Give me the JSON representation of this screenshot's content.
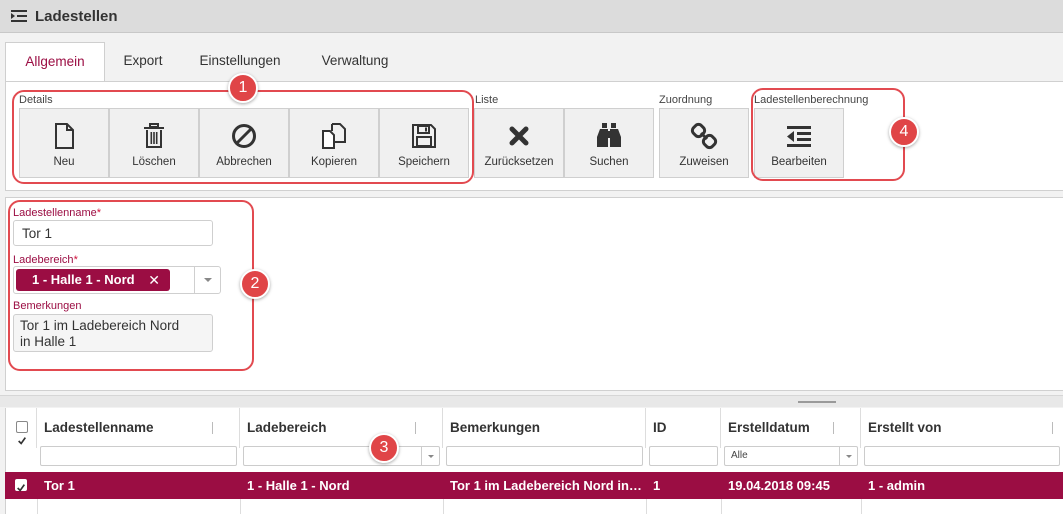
{
  "window": {
    "title": "Ladestellen"
  },
  "tabs": [
    {
      "label": "Allgemein"
    },
    {
      "label": "Export"
    },
    {
      "label": "Einstellungen"
    },
    {
      "label": "Verwaltung"
    }
  ],
  "toolbar": {
    "groups": {
      "details": "Details",
      "liste": "Liste",
      "zuordnung": "Zuordnung",
      "berechnung": "Ladestellenberechnung"
    },
    "buttons": {
      "neu": "Neu",
      "loeschen": "Löschen",
      "abbrechen": "Abbrechen",
      "kopieren": "Kopieren",
      "speichern": "Speichern",
      "zuruecksetzen": "Zurücksetzen",
      "suchen": "Suchen",
      "zuweisen": "Zuweisen",
      "bearbeiten": "Bearbeiten"
    }
  },
  "form": {
    "name_label": "Ladestellenname",
    "name_value": "Tor 1",
    "bereich_label": "Ladebereich",
    "bereich_value": "1 - Halle 1 - Nord",
    "bemerkungen_label": "Bemerkungen",
    "bemerkungen_value": "Tor 1 im Ladebereich Nord\nin Halle 1",
    "required_mark": "*"
  },
  "grid": {
    "columns": [
      "Ladestellenname",
      "Ladebereich",
      "Bemerkungen",
      "ID",
      "Erstelldatum",
      "Erstellt von"
    ],
    "filter_erstelldatum": "Alle",
    "rows": [
      {
        "name": "Tor 1",
        "bereich": "1 - Halle 1 - Nord",
        "bemerkungen": "Tor 1 im Ladebereich Nord in Halle 1",
        "id": "1",
        "erstelldatum": "19.04.2018 09:45",
        "erstellt_von": "1 - admin"
      }
    ]
  },
  "callouts": [
    "1",
    "2",
    "3",
    "4"
  ],
  "colors": {
    "accent": "#9b0d43",
    "callout": "#e24a50"
  },
  "icons": [
    "list-indent-icon",
    "file-icon",
    "trash-icon",
    "cancel-icon",
    "copy-icon",
    "save-icon",
    "x-icon",
    "binoculars-icon",
    "link-icon",
    "outdent-icon",
    "close-icon",
    "chevron-down-icon",
    "checkbox-icon"
  ]
}
